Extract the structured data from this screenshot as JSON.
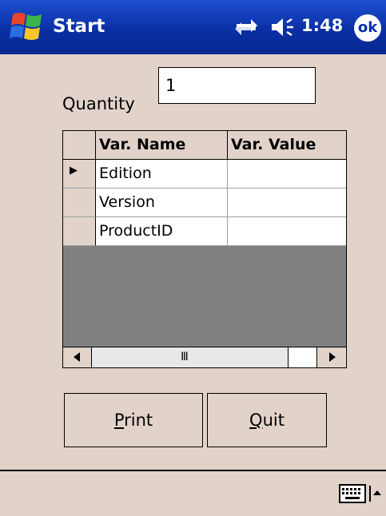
{
  "titlebar": {
    "title": "Start",
    "clock": "1:48",
    "ok_label": "ok"
  },
  "form": {
    "quantity_label": "Quantity",
    "quantity_value": "1"
  },
  "grid": {
    "columns": [
      "Var. Name",
      "Var. Value"
    ],
    "rows": [
      {
        "name": "Edition",
        "value": ""
      },
      {
        "name": "Version",
        "value": ""
      },
      {
        "name": "ProductID",
        "value": ""
      }
    ],
    "current_row_indicator": "▶",
    "scroll_grip": "Ⅲ"
  },
  "buttons": {
    "print_hotkey": "P",
    "print_rest": "rint",
    "quit_hotkey": "Q",
    "quit_rest": "uit"
  },
  "icons": {
    "start": "windows-flag-icon",
    "sync": "connectivity-icon",
    "speaker": "speaker-icon",
    "keyboard": "keyboard-icon",
    "sip": "up-arrow-icon"
  },
  "colors": {
    "titlebar": "#0a30a8",
    "form_bg": "#e1d3c9",
    "grid_empty": "#808080"
  }
}
